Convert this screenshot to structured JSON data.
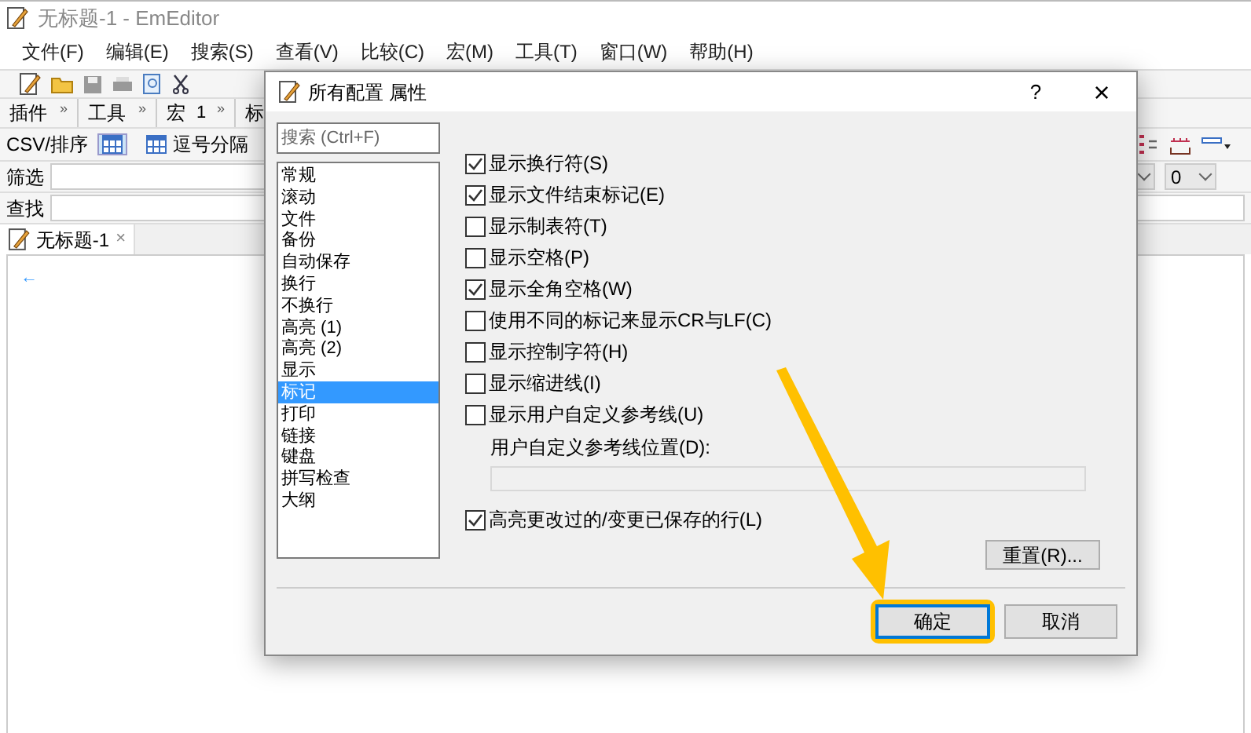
{
  "window": {
    "title": "无标题-1 - EmEditor"
  },
  "menu": [
    "文件(F)",
    "编辑(E)",
    "搜索(S)",
    "查看(V)",
    "比较(C)",
    "宏(M)",
    "工具(T)",
    "窗口(W)",
    "帮助(H)"
  ],
  "toolbar_bars": [
    {
      "label": "插件",
      "more": "»"
    },
    {
      "label": "工具",
      "more": "»"
    },
    {
      "label": "宏",
      "extra": "1",
      "more": "»"
    },
    {
      "label": "标"
    }
  ],
  "csv_bar": {
    "label": "CSV/排序",
    "button": "逗号分隔"
  },
  "filter_row": {
    "label": "筛选",
    "dropdown_value": "0"
  },
  "find_row": {
    "label": "查找"
  },
  "tab": {
    "label": "无标题-1",
    "close": "×"
  },
  "editor": {
    "marker": "←"
  },
  "dialog": {
    "title": "所有配置 属性",
    "help": "?",
    "close": "×",
    "search": {
      "placeholder": "搜索 (Ctrl+F)"
    },
    "categories": [
      {
        "label": "常规",
        "selected": false
      },
      {
        "label": "滚动",
        "selected": false
      },
      {
        "label": "文件",
        "selected": false
      },
      {
        "label": "备份",
        "selected": false
      },
      {
        "label": "自动保存",
        "selected": false
      },
      {
        "label": "换行",
        "selected": false
      },
      {
        "label": "不换行",
        "selected": false
      },
      {
        "label": "高亮 (1)",
        "selected": false
      },
      {
        "label": "高亮 (2)",
        "selected": false
      },
      {
        "label": "显示",
        "selected": false
      },
      {
        "label": "标记",
        "selected": true
      },
      {
        "label": "打印",
        "selected": false
      },
      {
        "label": "链接",
        "selected": false
      },
      {
        "label": "键盘",
        "selected": false
      },
      {
        "label": "拼写检查",
        "selected": false
      },
      {
        "label": "大纲",
        "selected": false
      }
    ],
    "options": [
      {
        "kind": "checkbox",
        "label": "显示换行符(S)",
        "checked": true
      },
      {
        "kind": "checkbox",
        "label": "显示文件结束标记(E)",
        "checked": true
      },
      {
        "kind": "checkbox",
        "label": "显示制表符(T)",
        "checked": false
      },
      {
        "kind": "checkbox",
        "label": "显示空格(P)",
        "checked": false
      },
      {
        "kind": "checkbox",
        "label": "显示全角空格(W)",
        "checked": true
      },
      {
        "kind": "checkbox",
        "label": "使用不同的标记来显示CR与LF(C)",
        "checked": false
      },
      {
        "kind": "checkbox",
        "label": "显示控制字符(H)",
        "checked": false
      },
      {
        "kind": "checkbox",
        "label": "显示缩进线(I)",
        "checked": false
      },
      {
        "kind": "checkbox",
        "label": "显示用户自定义参考线(U)",
        "checked": false
      },
      {
        "kind": "label",
        "label": "用户自定义参考线位置(D):"
      },
      {
        "kind": "field",
        "disabled": true
      },
      {
        "kind": "checkbox",
        "label": "高亮更改过的/变更已保存的行(L)",
        "checked": true
      }
    ],
    "reset": "重置(R)...",
    "ok": "确定",
    "cancel": "取消"
  }
}
